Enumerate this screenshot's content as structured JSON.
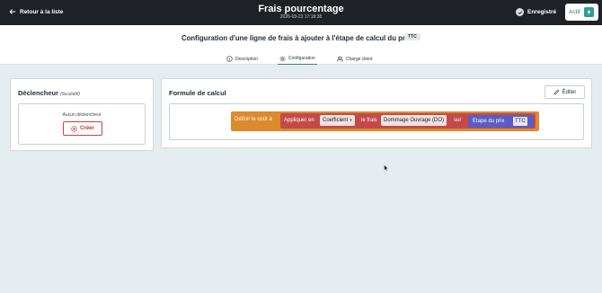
{
  "topbar": {
    "back_label": "Retour à la liste",
    "title": "Frais pourcentage",
    "timestamp": "2026-03-23 17:18:38",
    "saved_label": "Enregistré",
    "toggle_label": "Actif",
    "icons": {
      "back": "arrow-left-icon",
      "saved": "check-circle-icon",
      "toggle": "lightning-icon"
    }
  },
  "header": {
    "config_title": "Configuration d'une ligne de frais à ajouter à l'étape de calcul du prix",
    "badge": "TTC",
    "tabs": [
      {
        "label": "Description",
        "icon": "info-circle-icon",
        "active": false
      },
      {
        "label": "Configuration",
        "icon": "gear-icon",
        "active": true
      },
      {
        "label": "Charge client",
        "icon": "users-icon",
        "active": false
      }
    ]
  },
  "trigger_panel": {
    "title": "Déclencheur",
    "optional": "(facultatif)",
    "empty_text": "Aucun déclencheur",
    "create_label": "Créer",
    "create_icon": "plus-circle-icon"
  },
  "formula_panel": {
    "title": "Formule de calcul",
    "edit_label": "Éditer",
    "edit_icon": "pencil-icon",
    "block": {
      "outer_label": "Définir le coût à",
      "apply_label": "Appliquer en",
      "mode_value": "Coefficient",
      "fee_label": "le frais",
      "fee_value": "Dommage Ouvrage (DO)",
      "on_label": "sur",
      "stage_label": "Etape du prix",
      "stage_value": "TTC"
    }
  },
  "colors": {
    "topbar": "#1e2226",
    "accent": "#2e8a78",
    "danger": "#c63030",
    "block_orange": "#dd8a2c",
    "block_red": "#c44a4a",
    "block_purple": "#5b5cc4"
  }
}
